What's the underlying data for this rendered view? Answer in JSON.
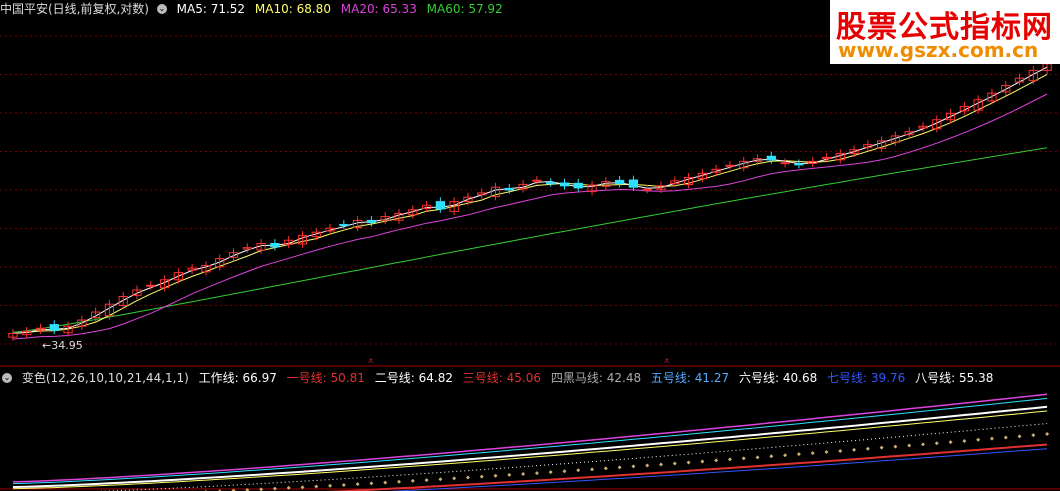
{
  "header": {
    "stock_title": "中国平安(日线,前复权,对数)",
    "ma": [
      {
        "label": "MA5: 71.52",
        "color": "#ffffff"
      },
      {
        "label": "MA10: 68.80",
        "color": "#ffff66"
      },
      {
        "label": "MA20: 65.33",
        "color": "#dd44dd"
      },
      {
        "label": "MA60: 57.92",
        "color": "#33cc33"
      }
    ]
  },
  "watermark": {
    "title": "股票公式指标网",
    "url": "www.gszx.com.cn"
  },
  "indicator": {
    "name": "变色(12,26,10,10,21,44,1,1)",
    "lines": [
      {
        "label": "工作线:",
        "value": "66.97",
        "color": "#ffffff"
      },
      {
        "label": "一号线:",
        "value": "50.81",
        "color": "#e03030"
      },
      {
        "label": "二号线:",
        "value": "64.82",
        "color": "#ffffff"
      },
      {
        "label": "三号线:",
        "value": "45.06",
        "color": "#e03030"
      },
      {
        "label": "四黑马线:",
        "value": "42.48",
        "color": "#aaaaaa"
      },
      {
        "label": "五号线:",
        "value": "41.27",
        "color": "#55aaff"
      },
      {
        "label": "六号线:",
        "value": "40.68",
        "color": "#ffffff"
      },
      {
        "label": "七号线:",
        "value": "39.76",
        "color": "#3355ff"
      },
      {
        "label": "八号线:",
        "value": "55.38",
        "color": "#ffffff"
      }
    ]
  },
  "chart_data": {
    "type": "candlestick",
    "scale": "log",
    "price_min_label": "34.95",
    "ma5_last": 71.52,
    "ma10_last": 68.8,
    "ma20_last": 65.33,
    "ma60_last": 57.92,
    "closes_approx": [
      34.9,
      35.1,
      35.4,
      35.2,
      35.6,
      36.2,
      37.0,
      37.8,
      38.6,
      39.3,
      39.8,
      40.4,
      41.2,
      41.7,
      42.0,
      42.8,
      43.5,
      44.1,
      44.6,
      44.2,
      45.0,
      45.6,
      46.0,
      46.5,
      46.9,
      47.5,
      47.2,
      48.0,
      48.4,
      48.9,
      49.5,
      49.0,
      50.0,
      50.6,
      51.2,
      52.0,
      51.6,
      52.4,
      53.0,
      52.6,
      52.2,
      51.9,
      52.3,
      52.8,
      52.5,
      52.0,
      51.7,
      52.2,
      52.9,
      53.4,
      54.0,
      54.6,
      55.2,
      55.8,
      56.2,
      56.0,
      55.6,
      55.3,
      55.8,
      56.4,
      57.0,
      57.6,
      58.4,
      59.0,
      59.8,
      60.5,
      61.4,
      62.5,
      63.6,
      64.8,
      66.0,
      67.2,
      68.6,
      70.0,
      71.5,
      72.8
    ],
    "signal_markers": 2,
    "indicator_values": {
      "工作线": 66.97,
      "一号线": 50.81,
      "二号线": 64.82,
      "三号线": 45.06,
      "四黑马线": 42.48,
      "五号线": 41.27,
      "六号线": 40.68,
      "七号线": 39.76,
      "八号线": 55.38
    }
  },
  "colors": {
    "up": "#ff3030",
    "down": "#30e0ff",
    "ma5": "#ffffff",
    "ma10": "#ffff66",
    "ma20": "#dd44dd",
    "ma60": "#33cc33",
    "grid": "#7a0000"
  }
}
